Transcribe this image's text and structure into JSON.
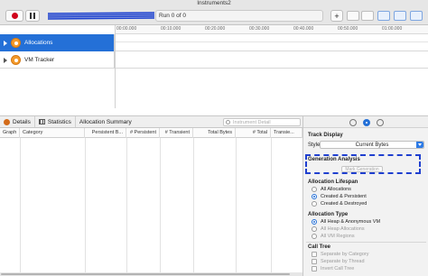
{
  "window": {
    "title": "Instruments2"
  },
  "toolbar": {
    "run_status": "Run 0 of 0",
    "target_redacted": "",
    "add_label": "+"
  },
  "timeline": {
    "ticks": [
      "00:00.000",
      "00:10.000",
      "00:20.000",
      "00:30.000",
      "00:40.000",
      "00:50.000",
      "01:00.000"
    ],
    "tracks": [
      {
        "label": "Allocations",
        "selected": true,
        "icon": "allocations-icon"
      },
      {
        "label": "VM Tracker",
        "selected": false,
        "icon": "vm-tracker-icon"
      }
    ]
  },
  "nav": {
    "details": "Details",
    "statistics": "Statistics",
    "summary": "Allocation Summary",
    "search_placeholder": "Instrument Detail"
  },
  "table": {
    "columns": [
      "Graph",
      "Category",
      "Persistent B...",
      "# Persistent",
      "# Transient",
      "Total Bytes",
      "# Total",
      "Transie..."
    ]
  },
  "inspector": {
    "track_display": "Track Display",
    "style_label": "Style",
    "style_value": "Current Bytes",
    "generation_analysis": "Generation Analysis",
    "mark_generation": "Mark Generation",
    "allocation_lifespan": "Allocation Lifespan",
    "lifespan_options": [
      "All Allocations",
      "Created & Persistent",
      "Created & Destroyed"
    ],
    "lifespan_selected": 1,
    "allocation_type": "Allocation Type",
    "type_options": [
      "All Heap & Anonymous VM",
      "All Heap Allocations",
      "All VM Regions"
    ],
    "call_tree": "Call Tree",
    "call_tree_options": [
      "Separate by Category",
      "Separate by Thread",
      "Invert Call Tree"
    ]
  },
  "colors": {
    "accent": "#2470d7",
    "record": "#d0021b",
    "highlight": "#1f3fcf"
  }
}
